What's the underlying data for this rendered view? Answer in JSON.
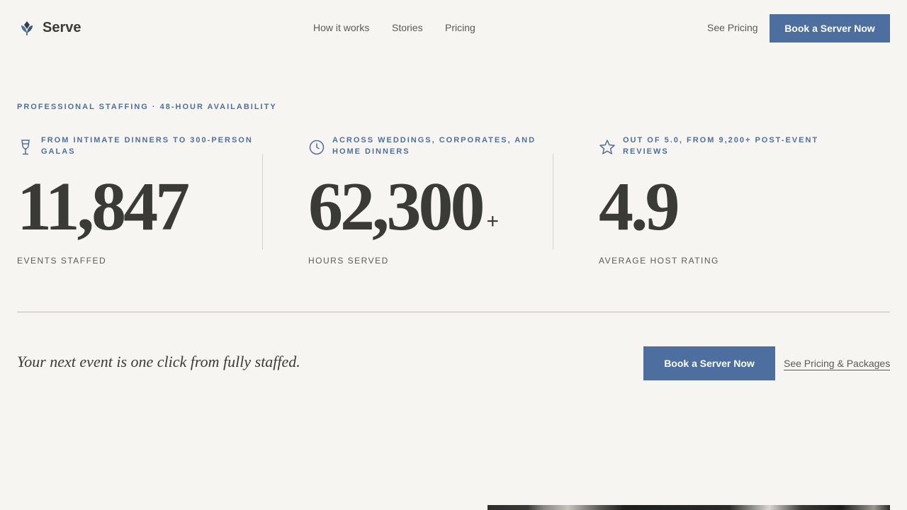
{
  "header": {
    "brand": "Serve",
    "nav": [
      "How it works",
      "Stories",
      "Pricing"
    ],
    "see_pricing": "See Pricing",
    "cta": "Book a Server Now",
    "logo_icon": "leaf-logo-icon"
  },
  "hero": {
    "eyebrow": "PROFESSIONAL STAFFING · 48-HOUR AVAILABILITY"
  },
  "stats": [
    {
      "icon": "wine-glass-icon",
      "caption": "FROM INTIMATE DINNERS TO 300-PERSON GALAS",
      "value": "11,847",
      "suffix": "",
      "label": "EVENTS STAFFED"
    },
    {
      "icon": "clock-icon",
      "caption": "ACROSS WEDDINGS, CORPORATES, AND HOME DINNERS",
      "value": "62,300",
      "suffix": "+",
      "label": "HOURS SERVED"
    },
    {
      "icon": "star-icon",
      "caption": "OUT OF 5.0, FROM 9,200+ POST-EVENT REVIEWS",
      "value": "4.9",
      "suffix": "",
      "label": "AVERAGE HOST RATING"
    }
  ],
  "cta": {
    "text": "Your next event is one click from fully staffed.",
    "button": "Book a Server Now",
    "link": "See Pricing & Packages"
  },
  "colors": {
    "accent": "#4d6fa0",
    "background": "#f6f5f2",
    "text": "#3a3a36"
  }
}
